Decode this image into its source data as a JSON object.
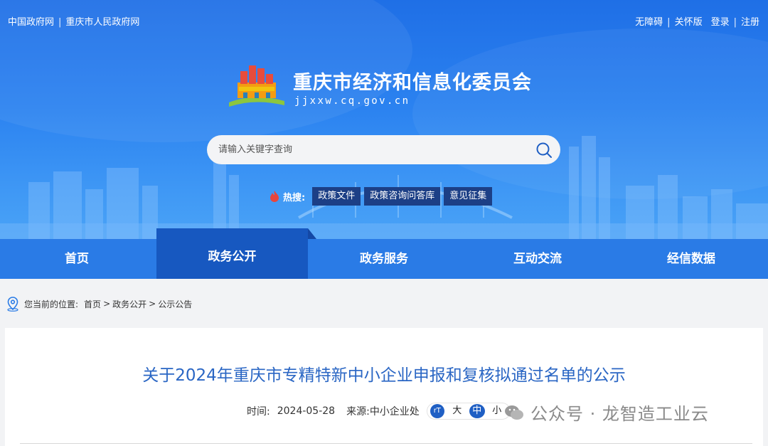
{
  "top_links_left": [
    "中国政府网",
    "重庆市人民政府网"
  ],
  "top_links_right": [
    "无障碍",
    "关怀版",
    "登录",
    "注册"
  ],
  "site": {
    "title": "重庆市经济和信息化委员会",
    "domain": "jjxxw.cq.gov.cn"
  },
  "search": {
    "placeholder": "请输入关键字查询"
  },
  "hot": {
    "label": "热搜:",
    "tags": [
      "政策文件",
      "政策咨询问答库",
      "意见征集"
    ]
  },
  "nav": {
    "items": [
      "首页",
      "政务公开",
      "政务服务",
      "互动交流",
      "经信数据"
    ],
    "active": "政务公开"
  },
  "breadcrumb": {
    "prefix": "您当前的位置:",
    "path": [
      "首页",
      "政务公开",
      "公示公告"
    ]
  },
  "article": {
    "title": "关于2024年重庆市专精特新中小企业申报和复核拟通过名单的公示",
    "time_label": "时间:",
    "time": "2024-05-28",
    "source_label": "来源:",
    "source": "中小企业处",
    "font_sizes": [
      "大",
      "中",
      "小"
    ],
    "font_size_selected": "中"
  },
  "watermark": {
    "text": "公众号 · 龙智造工业云"
  },
  "colors": {
    "banner_blue": "#2b82f0",
    "nav_blue": "#2a7be6",
    "nav_active": "#1758c0",
    "title_blue": "#2a66c4",
    "hot_tag_bg": "#1c3f86"
  }
}
